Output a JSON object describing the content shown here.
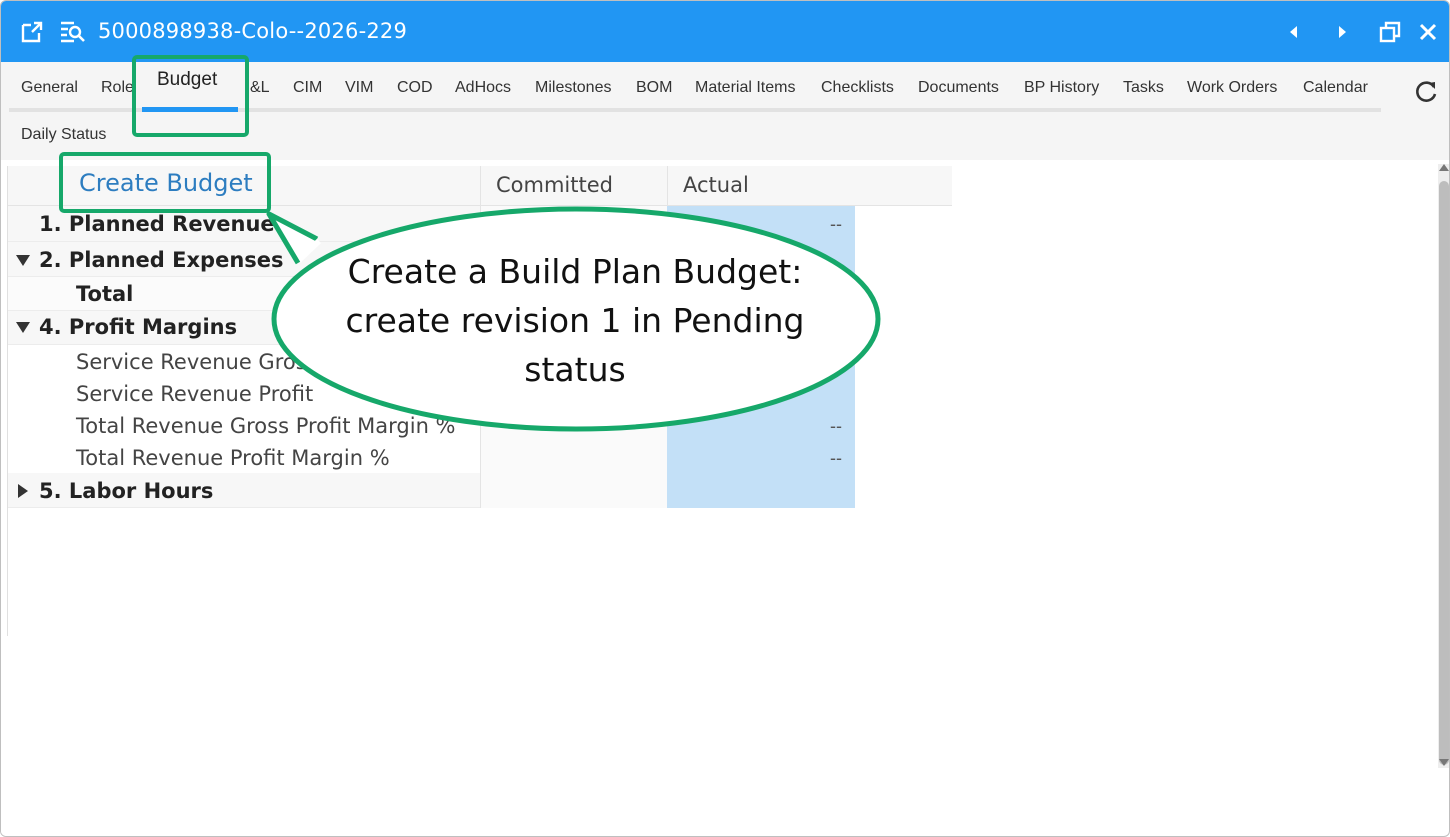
{
  "window": {
    "title": "5000898938-Colo--2026-229",
    "accent_color": "#2196f3",
    "icons": [
      "open-external-icon",
      "search-list-icon",
      "prev-icon",
      "next-icon",
      "restore-icon",
      "close-icon"
    ]
  },
  "tabs": {
    "row1": [
      "General",
      "Role",
      "Budget",
      "&L",
      "CIM",
      "VIM",
      "COD",
      "AdHocs",
      "Milestones",
      "BOM",
      "Material Items",
      "Checklists",
      "Documents",
      "BP History",
      "Tasks",
      "Work Orders",
      "Calendar"
    ],
    "row2": [
      "Daily Status"
    ],
    "active": "Budget"
  },
  "grid": {
    "create_budget_link": "Create Budget",
    "columns": [
      "Committed",
      "Actual"
    ],
    "rows": [
      {
        "label": "1. Planned Revenue",
        "actual": "--"
      },
      {
        "label": "2. Planned Expenses",
        "actual": ""
      },
      {
        "label": "Total",
        "actual": ""
      },
      {
        "label": "4. Profit Margins",
        "actual": ""
      },
      {
        "label": "Service Revenue Gros",
        "actual": ""
      },
      {
        "label": "Service Revenue Profit",
        "actual": ""
      },
      {
        "label": "Total Revenue Gross Profit Margin %",
        "actual": "--"
      },
      {
        "label": "Total Revenue Profit Margin %",
        "actual": "--"
      },
      {
        "label": "5. Labor Hours",
        "actual": ""
      }
    ]
  },
  "callout": {
    "text": "Create a Build Plan Budget: create revision 1 in Pending status",
    "border_color": "#16a86a"
  }
}
